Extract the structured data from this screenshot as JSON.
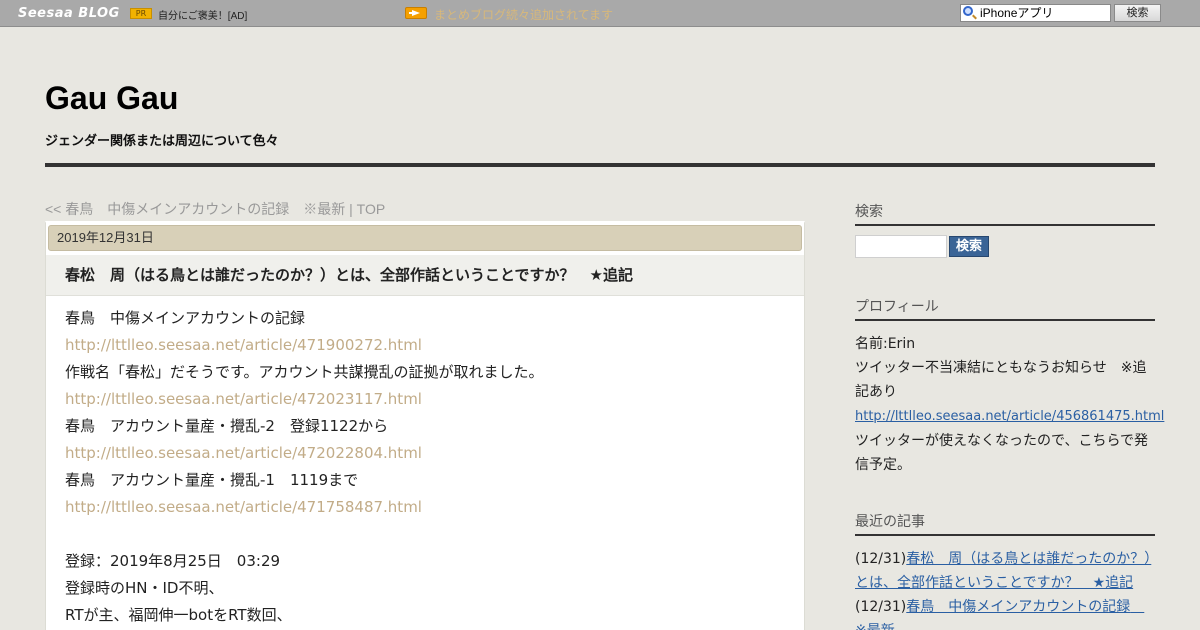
{
  "topbar": {
    "logo": "Seesaa BLOG",
    "pr_badge": "PR",
    "ad_text": "自分にご褒美！[AD]",
    "matome_text": "まとめブログ続々追加されてます",
    "search_value": "iPhoneアプリ",
    "search_button": "検索"
  },
  "header": {
    "title": "Gau Gau",
    "subtitle": "ジェンダー関係または周辺について色々"
  },
  "nav": {
    "prev": "<< 春鳥　中傷メインアカウントの記録　※最新",
    "sep": " | ",
    "top": "TOP"
  },
  "article": {
    "date": "2019年12月31日",
    "title": "春松　周（はる鳥とは誰だったのか？）とは、全部作話ということですか？　★追記",
    "lines": [
      "春鳥　中傷メインアカウントの記録",
      "http://lttlleo.seesaa.net/article/471900272.html",
      "作戦名「春松」だそうです。アカウント共謀攪乱の証拠が取れました。",
      "http://lttlleo.seesaa.net/article/472023117.html",
      "春鳥　アカウント量産・攪乱-2　登録1122から",
      "http://lttlleo.seesaa.net/article/472022804.html",
      "春鳥　アカウント量産・攪乱-1　1119まで",
      "http://lttlleo.seesaa.net/article/471758487.html",
      "",
      "登録：2019年8月25日　03:29",
      "登録時のHN・ID不明、",
      "RTが主、福岡伸一botをRT数回、"
    ]
  },
  "sidebar": {
    "search_heading": "検索",
    "search_button": "検索",
    "profile_heading": "プロフィール",
    "profile_name": "名前:Erin",
    "profile_text1": "ツイッター不当凍結にともなうお知らせ　※追記あり",
    "profile_link": "http://lttlleo.seesaa.net/article/456861475.html",
    "profile_text2": "ツイッターが使えなくなったので、こちらで発信予定。",
    "recent_heading": "最近の記事",
    "recent": [
      {
        "date": "(12/31)",
        "title": "春松　周（はる鳥とは誰だったのか？）とは、全部作話ということですか？　★追記"
      },
      {
        "date": "(12/31)",
        "title": "春鳥　中傷メインアカウントの記録　※最新"
      }
    ]
  }
}
